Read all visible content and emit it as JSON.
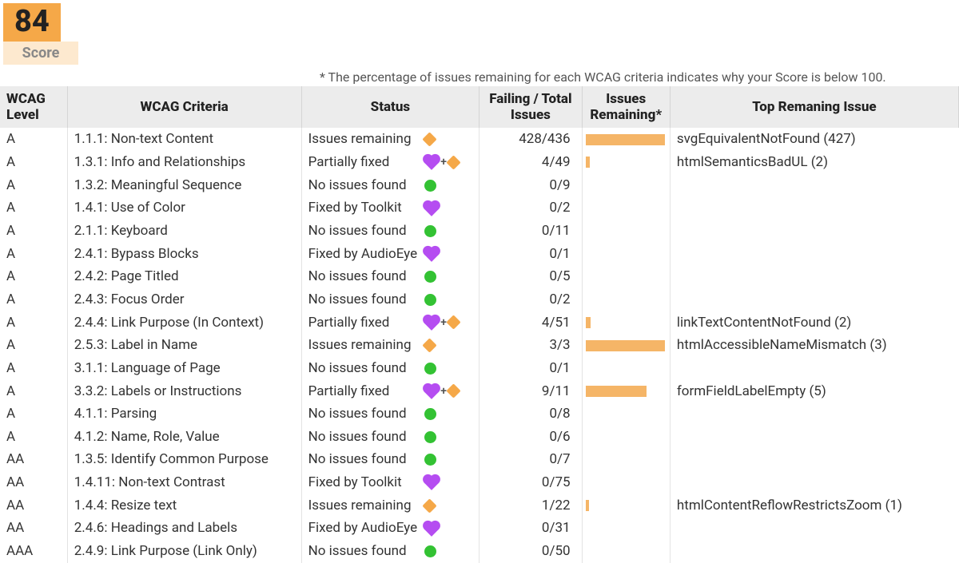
{
  "score": {
    "value": "84",
    "label": "Score"
  },
  "note": "* The percentage of issues remaining for each WCAG criteria indicates why your Score is below 100.",
  "headers": {
    "level": "WCAG Level",
    "criteria": "WCAG Criteria",
    "status": "Status",
    "failing": "Failing / Total Issues",
    "remaining": "Issues Remaining*",
    "top": "Top Remaning Issue"
  },
  "rows": [
    {
      "level": "A",
      "criteria": "1.1.1: Non-text Content",
      "status": "Issues remaining",
      "icons": [
        "diamond"
      ],
      "failing": "428/436",
      "bar": 98,
      "top": "svgEquivalentNotFound (427)"
    },
    {
      "level": "A",
      "criteria": "1.3.1: Info and Relationships",
      "status": "Partially fixed",
      "icons": [
        "heart",
        "plus",
        "diamond"
      ],
      "failing": "4/49",
      "bar": 5,
      "top": "htmlSemanticsBadUL (2)"
    },
    {
      "level": "A",
      "criteria": "1.3.2: Meaningful Sequence",
      "status": "No issues found",
      "icons": [
        "green"
      ],
      "failing": "0/9",
      "bar": 0,
      "top": ""
    },
    {
      "level": "A",
      "criteria": "1.4.1: Use of Color",
      "status": "Fixed by Toolkit",
      "icons": [
        "heart"
      ],
      "failing": "0/2",
      "bar": 0,
      "top": ""
    },
    {
      "level": "A",
      "criteria": "2.1.1: Keyboard",
      "status": "No issues found",
      "icons": [
        "green"
      ],
      "failing": "0/11",
      "bar": 0,
      "top": ""
    },
    {
      "level": "A",
      "criteria": "2.4.1: Bypass Blocks",
      "status": "Fixed by AudioEye",
      "icons": [
        "heart"
      ],
      "failing": "0/1",
      "bar": 0,
      "top": ""
    },
    {
      "level": "A",
      "criteria": "2.4.2: Page Titled",
      "status": "No issues found",
      "icons": [
        "green"
      ],
      "failing": "0/5",
      "bar": 0,
      "top": ""
    },
    {
      "level": "A",
      "criteria": "2.4.3: Focus Order",
      "status": "No issues found",
      "icons": [
        "green"
      ],
      "failing": "0/2",
      "bar": 0,
      "top": ""
    },
    {
      "level": "A",
      "criteria": "2.4.4: Link Purpose (In Context)",
      "status": "Partially fixed",
      "icons": [
        "heart",
        "plus",
        "diamond"
      ],
      "failing": "4/51",
      "bar": 6,
      "top": "linkTextContentNotFound (2)"
    },
    {
      "level": "A",
      "criteria": "2.5.3: Label in Name",
      "status": "Issues remaining",
      "icons": [
        "diamond"
      ],
      "failing": "3/3",
      "bar": 98,
      "top": "htmlAccessibleNameMismatch (3)"
    },
    {
      "level": "A",
      "criteria": "3.1.1: Language of Page",
      "status": "No issues found",
      "icons": [
        "green"
      ],
      "failing": "0/1",
      "bar": 0,
      "top": ""
    },
    {
      "level": "A",
      "criteria": "3.3.2: Labels or Instructions",
      "status": "Partially fixed",
      "icons": [
        "heart",
        "plus",
        "diamond"
      ],
      "failing": "9/11",
      "bar": 75,
      "top": "formFieldLabelEmpty (5)"
    },
    {
      "level": "A",
      "criteria": "4.1.1: Parsing",
      "status": "No issues found",
      "icons": [
        "green"
      ],
      "failing": "0/8",
      "bar": 0,
      "top": ""
    },
    {
      "level": "A",
      "criteria": "4.1.2: Name, Role, Value",
      "status": "No issues found",
      "icons": [
        "green"
      ],
      "failing": "0/6",
      "bar": 0,
      "top": ""
    },
    {
      "level": "AA",
      "criteria": "1.3.5: Identify Common Purpose",
      "status": "No issues found",
      "icons": [
        "green"
      ],
      "failing": "0/7",
      "bar": 0,
      "top": ""
    },
    {
      "level": "AA",
      "criteria": "1.4.11: Non-text Contrast",
      "status": "Fixed by Toolkit",
      "icons": [
        "heart"
      ],
      "failing": "0/75",
      "bar": 0,
      "top": ""
    },
    {
      "level": "AA",
      "criteria": "1.4.4: Resize text",
      "status": "Issues remaining",
      "icons": [
        "diamond"
      ],
      "failing": "1/22",
      "bar": 4,
      "top": "htmlContentReflowRestrictsZoom (1)"
    },
    {
      "level": "AA",
      "criteria": "2.4.6: Headings and Labels",
      "status": "Fixed by AudioEye",
      "icons": [
        "heart"
      ],
      "failing": "0/31",
      "bar": 0,
      "top": ""
    },
    {
      "level": "AAA",
      "criteria": "2.4.9: Link Purpose (Link Only)",
      "status": "No issues found",
      "icons": [
        "green"
      ],
      "failing": "0/50",
      "bar": 0,
      "top": ""
    }
  ]
}
